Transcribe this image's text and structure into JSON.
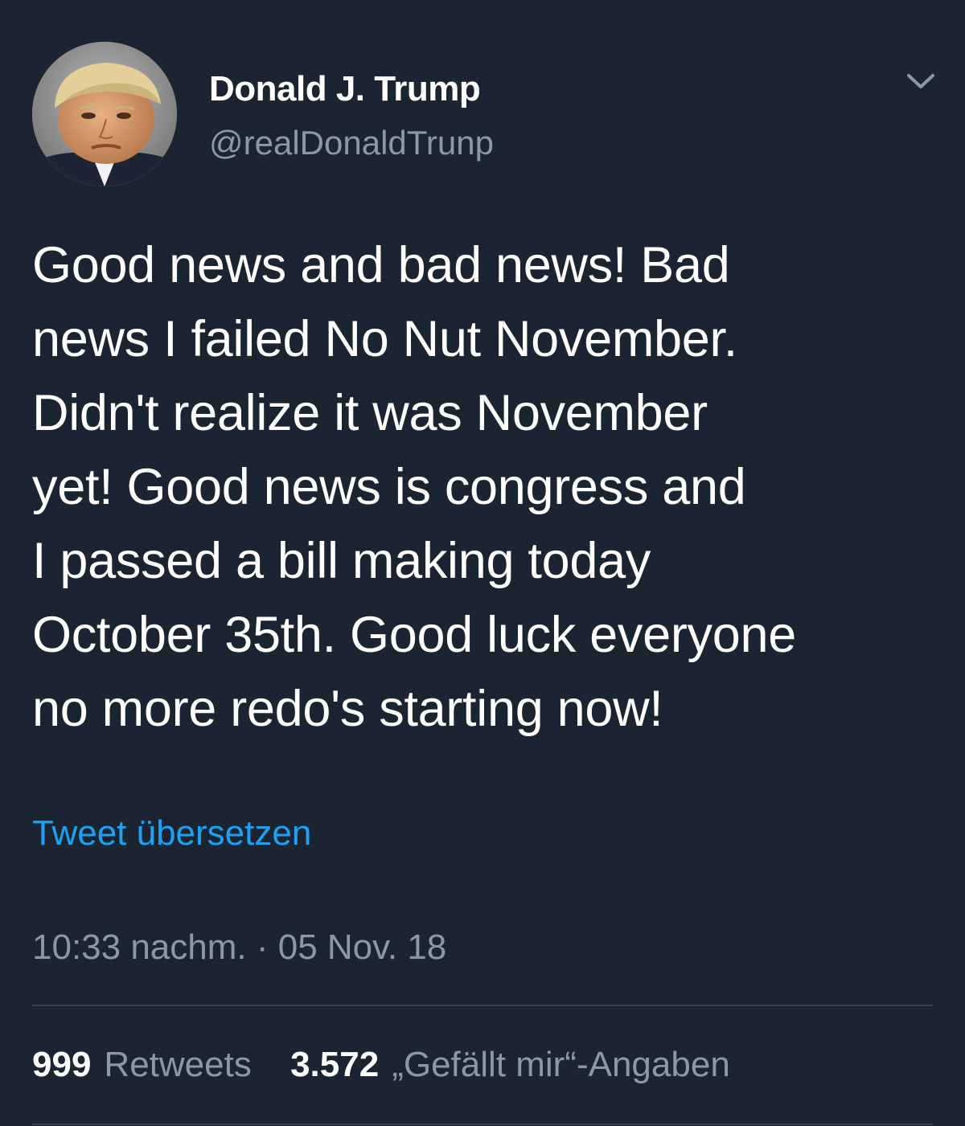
{
  "author": {
    "display_name": "Donald J. Trump",
    "handle": "@realDonaldTrunp",
    "avatar_icon": "profile-photo"
  },
  "tweet": {
    "text": "Good news and bad news! Bad\nnews I failed No Nut November.\nDidn't realize it was November\nyet! Good news is congress and\nI passed a bill making today\nOctober 35th. Good luck everyone\nno more redo's starting now!",
    "translate_label": "Tweet übersetzen",
    "timestamp": "10:33 nachm. · 05 Nov. 18"
  },
  "stats": {
    "retweets_count": "999",
    "retweets_label": "Retweets",
    "likes_count": "3.572",
    "likes_label": "„Gefällt mir“-Angaben"
  },
  "icons": {
    "menu": "chevron-down-icon"
  },
  "colors": {
    "background": "#1b2431",
    "text": "#ffffff",
    "secondary_text": "#8b98a5",
    "link": "#1da1f2",
    "divider": "#38444d"
  }
}
